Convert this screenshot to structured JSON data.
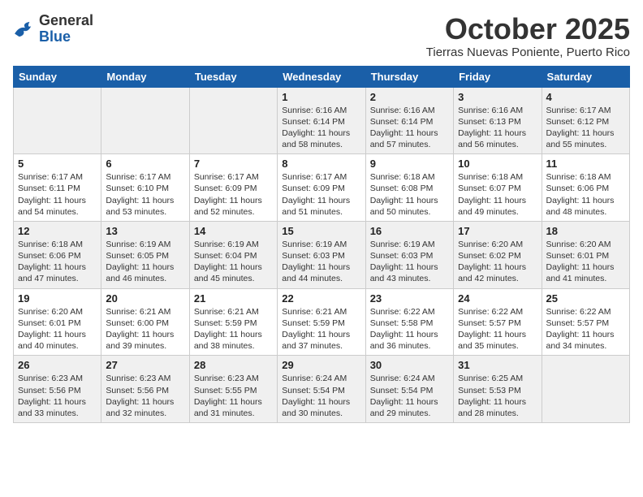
{
  "header": {
    "logo_general": "General",
    "logo_blue": "Blue",
    "month_title": "October 2025",
    "subtitle": "Tierras Nuevas Poniente, Puerto Rico"
  },
  "days_of_week": [
    "Sunday",
    "Monday",
    "Tuesday",
    "Wednesday",
    "Thursday",
    "Friday",
    "Saturday"
  ],
  "weeks": [
    [
      {
        "day": "",
        "sunrise": "",
        "sunset": "",
        "daylight": ""
      },
      {
        "day": "",
        "sunrise": "",
        "sunset": "",
        "daylight": ""
      },
      {
        "day": "",
        "sunrise": "",
        "sunset": "",
        "daylight": ""
      },
      {
        "day": "1",
        "sunrise": "Sunrise: 6:16 AM",
        "sunset": "Sunset: 6:14 PM",
        "daylight": "Daylight: 11 hours and 58 minutes."
      },
      {
        "day": "2",
        "sunrise": "Sunrise: 6:16 AM",
        "sunset": "Sunset: 6:14 PM",
        "daylight": "Daylight: 11 hours and 57 minutes."
      },
      {
        "day": "3",
        "sunrise": "Sunrise: 6:16 AM",
        "sunset": "Sunset: 6:13 PM",
        "daylight": "Daylight: 11 hours and 56 minutes."
      },
      {
        "day": "4",
        "sunrise": "Sunrise: 6:17 AM",
        "sunset": "Sunset: 6:12 PM",
        "daylight": "Daylight: 11 hours and 55 minutes."
      }
    ],
    [
      {
        "day": "5",
        "sunrise": "Sunrise: 6:17 AM",
        "sunset": "Sunset: 6:11 PM",
        "daylight": "Daylight: 11 hours and 54 minutes."
      },
      {
        "day": "6",
        "sunrise": "Sunrise: 6:17 AM",
        "sunset": "Sunset: 6:10 PM",
        "daylight": "Daylight: 11 hours and 53 minutes."
      },
      {
        "day": "7",
        "sunrise": "Sunrise: 6:17 AM",
        "sunset": "Sunset: 6:09 PM",
        "daylight": "Daylight: 11 hours and 52 minutes."
      },
      {
        "day": "8",
        "sunrise": "Sunrise: 6:17 AM",
        "sunset": "Sunset: 6:09 PM",
        "daylight": "Daylight: 11 hours and 51 minutes."
      },
      {
        "day": "9",
        "sunrise": "Sunrise: 6:18 AM",
        "sunset": "Sunset: 6:08 PM",
        "daylight": "Daylight: 11 hours and 50 minutes."
      },
      {
        "day": "10",
        "sunrise": "Sunrise: 6:18 AM",
        "sunset": "Sunset: 6:07 PM",
        "daylight": "Daylight: 11 hours and 49 minutes."
      },
      {
        "day": "11",
        "sunrise": "Sunrise: 6:18 AM",
        "sunset": "Sunset: 6:06 PM",
        "daylight": "Daylight: 11 hours and 48 minutes."
      }
    ],
    [
      {
        "day": "12",
        "sunrise": "Sunrise: 6:18 AM",
        "sunset": "Sunset: 6:06 PM",
        "daylight": "Daylight: 11 hours and 47 minutes."
      },
      {
        "day": "13",
        "sunrise": "Sunrise: 6:19 AM",
        "sunset": "Sunset: 6:05 PM",
        "daylight": "Daylight: 11 hours and 46 minutes."
      },
      {
        "day": "14",
        "sunrise": "Sunrise: 6:19 AM",
        "sunset": "Sunset: 6:04 PM",
        "daylight": "Daylight: 11 hours and 45 minutes."
      },
      {
        "day": "15",
        "sunrise": "Sunrise: 6:19 AM",
        "sunset": "Sunset: 6:03 PM",
        "daylight": "Daylight: 11 hours and 44 minutes."
      },
      {
        "day": "16",
        "sunrise": "Sunrise: 6:19 AM",
        "sunset": "Sunset: 6:03 PM",
        "daylight": "Daylight: 11 hours and 43 minutes."
      },
      {
        "day": "17",
        "sunrise": "Sunrise: 6:20 AM",
        "sunset": "Sunset: 6:02 PM",
        "daylight": "Daylight: 11 hours and 42 minutes."
      },
      {
        "day": "18",
        "sunrise": "Sunrise: 6:20 AM",
        "sunset": "Sunset: 6:01 PM",
        "daylight": "Daylight: 11 hours and 41 minutes."
      }
    ],
    [
      {
        "day": "19",
        "sunrise": "Sunrise: 6:20 AM",
        "sunset": "Sunset: 6:01 PM",
        "daylight": "Daylight: 11 hours and 40 minutes."
      },
      {
        "day": "20",
        "sunrise": "Sunrise: 6:21 AM",
        "sunset": "Sunset: 6:00 PM",
        "daylight": "Daylight: 11 hours and 39 minutes."
      },
      {
        "day": "21",
        "sunrise": "Sunrise: 6:21 AM",
        "sunset": "Sunset: 5:59 PM",
        "daylight": "Daylight: 11 hours and 38 minutes."
      },
      {
        "day": "22",
        "sunrise": "Sunrise: 6:21 AM",
        "sunset": "Sunset: 5:59 PM",
        "daylight": "Daylight: 11 hours and 37 minutes."
      },
      {
        "day": "23",
        "sunrise": "Sunrise: 6:22 AM",
        "sunset": "Sunset: 5:58 PM",
        "daylight": "Daylight: 11 hours and 36 minutes."
      },
      {
        "day": "24",
        "sunrise": "Sunrise: 6:22 AM",
        "sunset": "Sunset: 5:57 PM",
        "daylight": "Daylight: 11 hours and 35 minutes."
      },
      {
        "day": "25",
        "sunrise": "Sunrise: 6:22 AM",
        "sunset": "Sunset: 5:57 PM",
        "daylight": "Daylight: 11 hours and 34 minutes."
      }
    ],
    [
      {
        "day": "26",
        "sunrise": "Sunrise: 6:23 AM",
        "sunset": "Sunset: 5:56 PM",
        "daylight": "Daylight: 11 hours and 33 minutes."
      },
      {
        "day": "27",
        "sunrise": "Sunrise: 6:23 AM",
        "sunset": "Sunset: 5:56 PM",
        "daylight": "Daylight: 11 hours and 32 minutes."
      },
      {
        "day": "28",
        "sunrise": "Sunrise: 6:23 AM",
        "sunset": "Sunset: 5:55 PM",
        "daylight": "Daylight: 11 hours and 31 minutes."
      },
      {
        "day": "29",
        "sunrise": "Sunrise: 6:24 AM",
        "sunset": "Sunset: 5:54 PM",
        "daylight": "Daylight: 11 hours and 30 minutes."
      },
      {
        "day": "30",
        "sunrise": "Sunrise: 6:24 AM",
        "sunset": "Sunset: 5:54 PM",
        "daylight": "Daylight: 11 hours and 29 minutes."
      },
      {
        "day": "31",
        "sunrise": "Sunrise: 6:25 AM",
        "sunset": "Sunset: 5:53 PM",
        "daylight": "Daylight: 11 hours and 28 minutes."
      },
      {
        "day": "",
        "sunrise": "",
        "sunset": "",
        "daylight": ""
      }
    ]
  ]
}
